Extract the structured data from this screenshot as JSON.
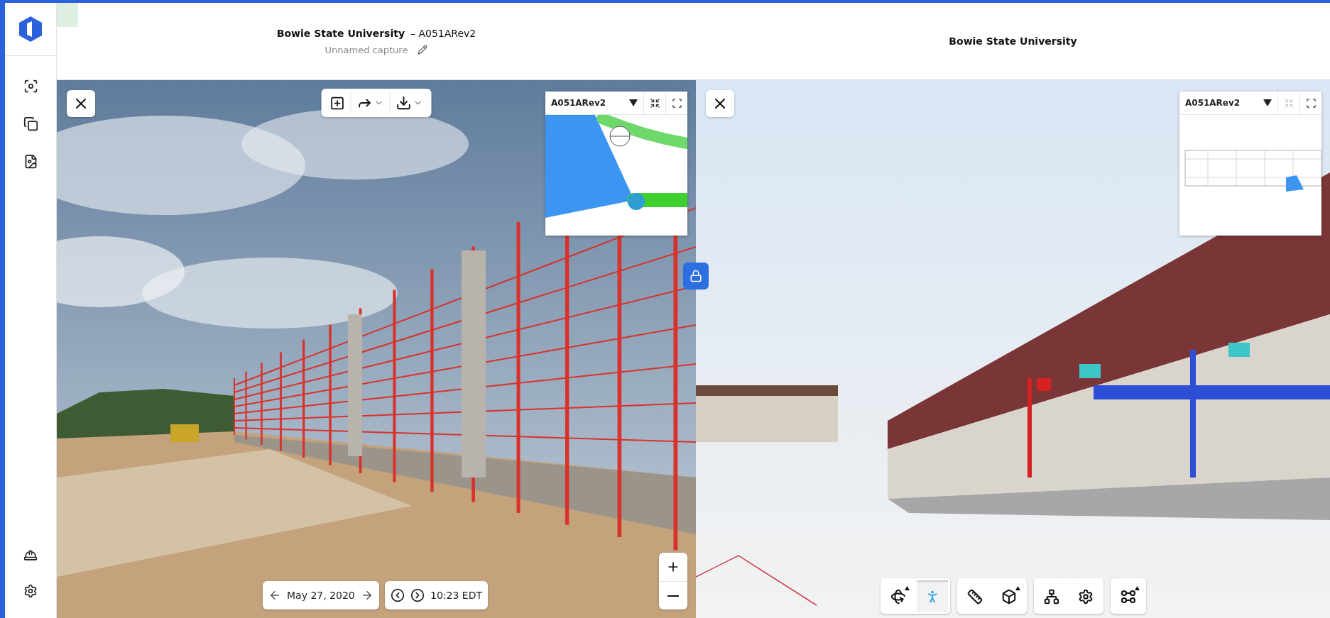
{
  "capture_pane": {
    "title": "Bowie State University",
    "model": "– A051ARev2",
    "capture_name": "Unnamed capture",
    "minimap": {
      "sheet": "A051ARev2",
      "shrink_disabled": false
    },
    "date": "May 27, 2020",
    "time": "10:23 EDT"
  },
  "model_pane": {
    "title": "Bowie State University",
    "minimap": {
      "sheet": "A051ARev2",
      "shrink_disabled": true
    },
    "tool_groups": [
      {
        "tools": [
          {
            "kind": "orbit",
            "selected": false,
            "has_menu": true
          },
          {
            "kind": "walk",
            "selected": true,
            "has_menu": false
          }
        ]
      },
      {
        "tools": [
          {
            "kind": "measure",
            "selected": false,
            "has_menu": false
          },
          {
            "kind": "section",
            "selected": false,
            "has_menu": true
          }
        ]
      },
      {
        "tools": [
          {
            "kind": "tree",
            "selected": false,
            "has_menu": false
          },
          {
            "kind": "settings",
            "selected": false,
            "has_menu": false
          }
        ]
      },
      {
        "tools": [
          {
            "kind": "nodes",
            "selected": false,
            "has_menu": true
          }
        ]
      }
    ]
  }
}
